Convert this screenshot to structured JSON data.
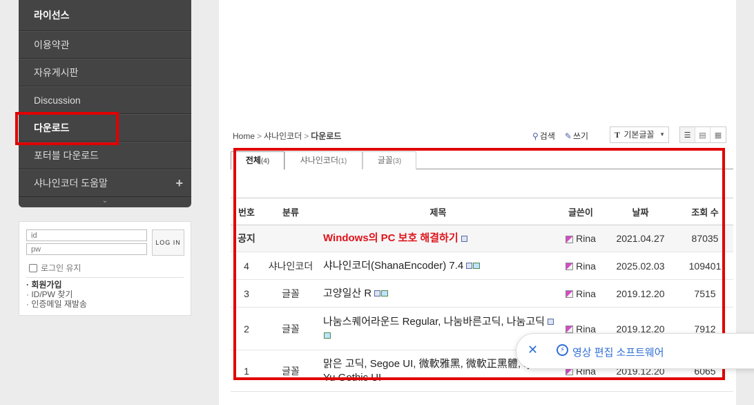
{
  "sidebar": {
    "items": [
      {
        "label": "라이선스",
        "bold": true
      },
      {
        "label": "이용약관"
      },
      {
        "label": "자유게시판"
      },
      {
        "label": "Discussion"
      },
      {
        "label": "다운로드",
        "bold": true
      },
      {
        "label": "포터블 다운로드"
      },
      {
        "label": "샤나인코더 도움말",
        "has_plus": true
      }
    ],
    "plus_glyph": "+",
    "foot_glyph": "⌄"
  },
  "login": {
    "id_placeholder": "id",
    "pw_placeholder": "pw",
    "login_button": "LOG IN",
    "keep_login": "로그인 유지",
    "links": [
      "· 회원가입",
      "· ID/PW 찾기",
      "· 인증메일 재발송"
    ]
  },
  "breadcrumb": {
    "home": "Home",
    "level1": "샤나인코더",
    "current": "다운로드",
    "sep": ">"
  },
  "tools": {
    "search": "검색",
    "write": "쓰기",
    "font_label": "기본글꼴",
    "font_t": "T"
  },
  "tabs": [
    {
      "label": "전체",
      "count": "(4)",
      "active": true
    },
    {
      "label": "샤나인코더",
      "count": "(1)"
    },
    {
      "label": "글꼴",
      "count": "(3)"
    }
  ],
  "table": {
    "headers": [
      "번호",
      "분류",
      "제목",
      "글쓴이",
      "날짜",
      "조회 수"
    ],
    "rows": [
      {
        "num": "공지",
        "category": "",
        "title": "Windows의 PC 보호 해결하기",
        "author": "Rina",
        "date": "2021.04.27",
        "views": "87035"
      },
      {
        "num": "4",
        "category": "샤나인코더",
        "title": "샤나인코더(ShanaEncoder) 7.4",
        "author": "Rina",
        "date": "2025.02.03",
        "views": "109401"
      },
      {
        "num": "3",
        "category": "글꼴",
        "title": "고양일산 R",
        "author": "Rina",
        "date": "2019.12.20",
        "views": "7515"
      },
      {
        "num": "2",
        "category": "글꼴",
        "title": "나눔스퀘어라운드 Regular, 나눔바른고딕, 나눔고딕",
        "author": "Rina",
        "date": "2019.12.20",
        "views": "7912"
      },
      {
        "num": "1",
        "category": "글꼴",
        "title": "맑은 고딕, Segoe UI, 微軟雅黑, 微軟正黑體, ryo UI, Yu Gothic UI",
        "author": "Rina",
        "date": "2019.12.20",
        "views": "6065"
      }
    ]
  },
  "toast": {
    "close": "✕",
    "message": "영상 편집 소프트웨어"
  },
  "colors": {
    "highlight": "#e00000",
    "notice_title": "#e0121a",
    "toast_blue": "#2f6fd6",
    "sidebar_bg": "#444444"
  }
}
